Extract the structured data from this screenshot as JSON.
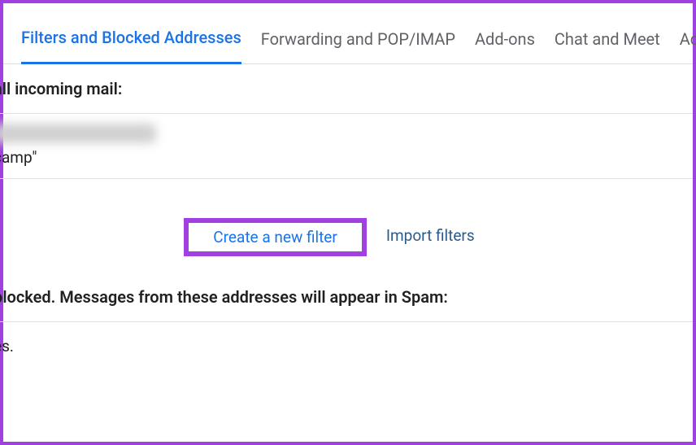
{
  "tabs": {
    "filters": "Filters and Blocked Addresses",
    "forwarding": "Forwarding and POP/IMAP",
    "addons": "Add-ons",
    "chat": "Chat and Meet",
    "advanced": "Advanced"
  },
  "sections": {
    "incoming_heading": "all incoming mail:",
    "filter_subject": "camp\"",
    "create_filter": "Create a new filter",
    "import_filters": "Import filters",
    "blocked_heading": "olocked. Messages from these addresses will appear in Spam:",
    "blocked_item": "es."
  }
}
